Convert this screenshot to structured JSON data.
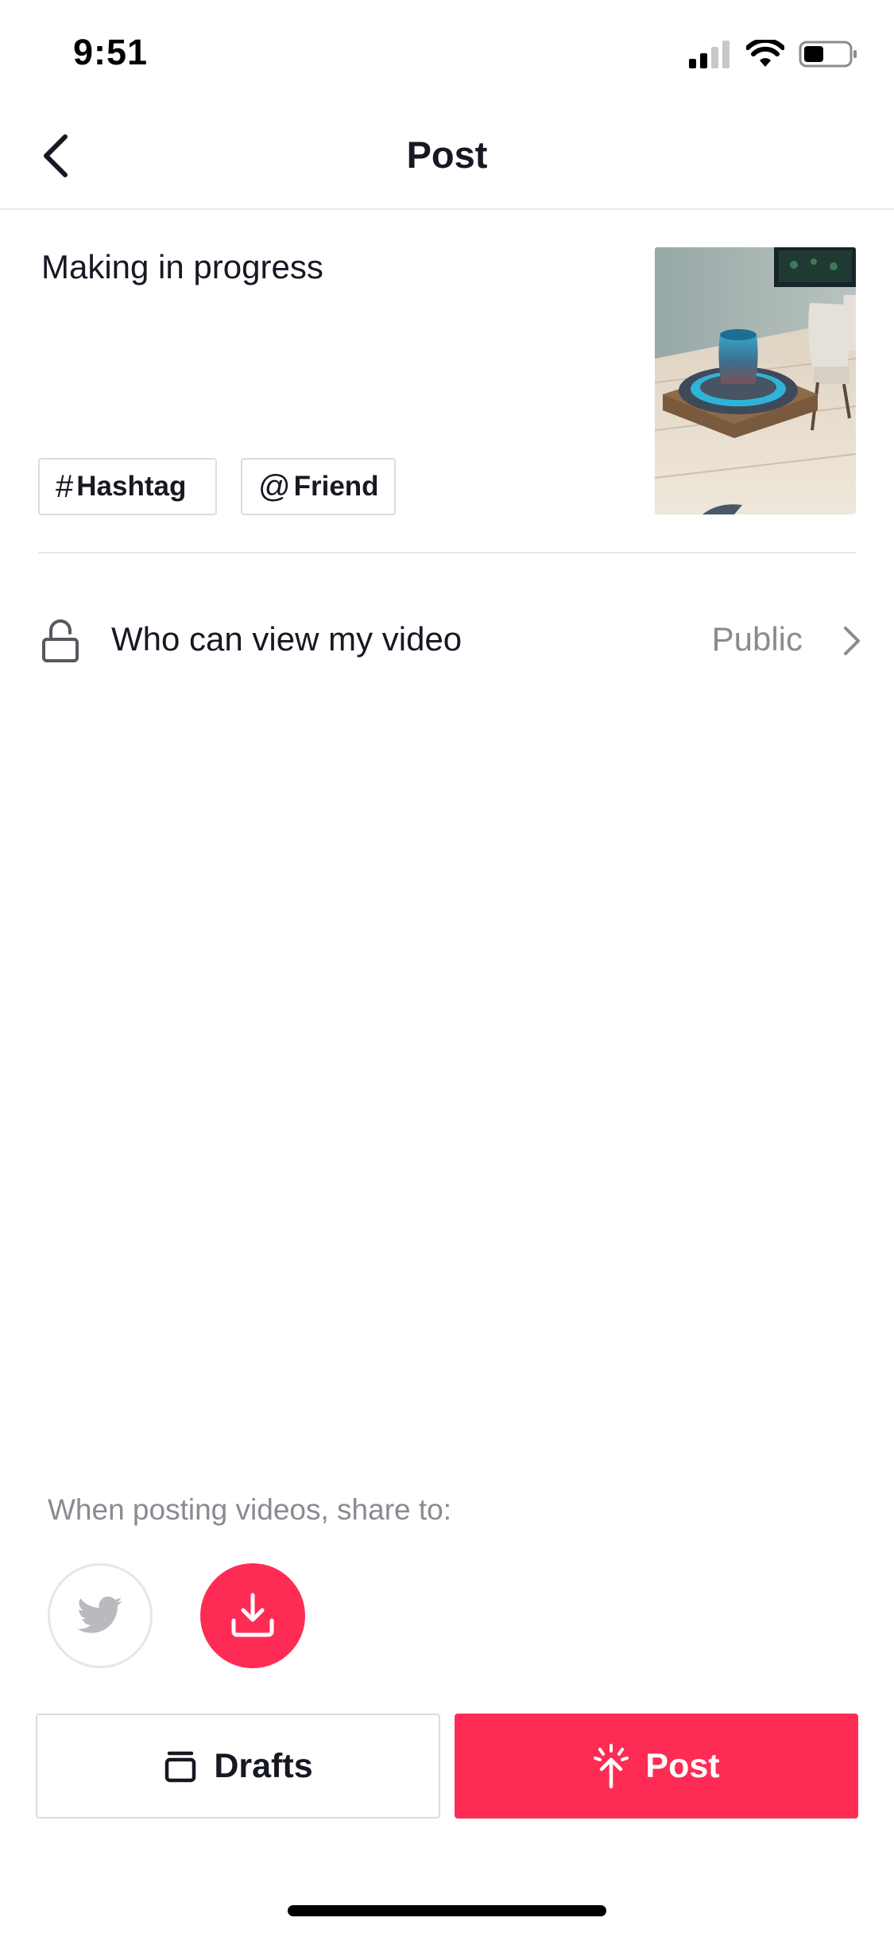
{
  "status_bar": {
    "time": "9:51",
    "icons": [
      "cellular-signal-icon",
      "wifi-icon",
      "battery-icon"
    ]
  },
  "header": {
    "title": "Post",
    "back_icon": "chevron-left-icon"
  },
  "caption": {
    "text": "Making in progress"
  },
  "tags": {
    "hashtag_symbol": "#",
    "hashtag_label": "Hashtag",
    "friend_symbol": "@",
    "friend_label": "Friend"
  },
  "privacy": {
    "icon": "unlock-icon",
    "label": "Who can view my video",
    "value": "Public"
  },
  "share": {
    "label": "When posting videos, share to:",
    "targets": [
      "twitter-icon",
      "download-icon"
    ]
  },
  "actions": {
    "drafts_label": "Drafts",
    "post_label": "Post"
  },
  "colors": {
    "accent": "#fe2c55",
    "text_primary": "#161823",
    "text_secondary": "#8a8b91",
    "divider": "#e8e8ea"
  }
}
